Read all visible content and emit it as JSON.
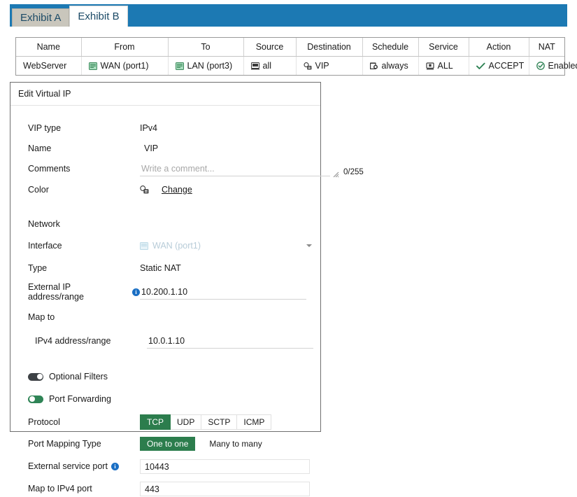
{
  "tabs": [
    {
      "label": "Exhibit A",
      "active": false
    },
    {
      "label": "Exhibit B",
      "active": true
    }
  ],
  "policy_table": {
    "headers": [
      "Name",
      "From",
      "To",
      "Source",
      "Destination",
      "Schedule",
      "Service",
      "Action",
      "NAT"
    ],
    "rows": [
      {
        "name": "WebServer",
        "from": "WAN (port1)",
        "from_icon": "interface-icon",
        "to": "LAN (port3)",
        "to_icon": "interface-icon",
        "source": "all",
        "source_icon": "address-icon",
        "destination": "VIP",
        "destination_icon": "vip-icon",
        "schedule": "always",
        "schedule_icon": "clock-icon",
        "service": "ALL",
        "service_icon": "service-icon",
        "action": "ACCEPT",
        "action_icon": "check-icon",
        "nat": "Enabled",
        "nat_icon": "check-circle-icon"
      }
    ]
  },
  "panel": {
    "title": "Edit Virtual IP",
    "fields": {
      "vip_type_label": "VIP type",
      "vip_type_value": "IPv4",
      "name_label": "Name",
      "name_value": "VIP",
      "comments_label": "Comments",
      "comments_value": "",
      "comments_placeholder": "Write a comment...",
      "comments_counter": "0/255",
      "color_label": "Color",
      "color_change_label": "Change",
      "color_icon": "color-palette-icon"
    },
    "network": {
      "section_label": "Network",
      "interface_label": "Interface",
      "interface_value": "WAN (port1)",
      "interface_icon": "interface-icon",
      "type_label": "Type",
      "type_value": "Static NAT",
      "external_ip_label": "External IP address/range",
      "external_ip_value": "10.200.1.10",
      "map_to_label": "Map to",
      "ipv4_range_label": "IPv4 address/range",
      "ipv4_range_value": "10.0.1.10"
    },
    "toggles": {
      "optional_filters_label": "Optional Filters",
      "optional_filters_on": false,
      "port_forwarding_label": "Port Forwarding",
      "port_forwarding_on": true
    },
    "port_forwarding": {
      "protocol_label": "Protocol",
      "protocol_options": [
        "TCP",
        "UDP",
        "SCTP",
        "ICMP"
      ],
      "protocol_selected": "TCP",
      "mapping_type_label": "Port Mapping Type",
      "mapping_type_options": [
        "One to one",
        "Many to many"
      ],
      "mapping_type_selected": "One to one",
      "external_service_port_label": "External service port",
      "external_service_port_value": "10443",
      "map_to_ipv4_port_label": "Map to IPv4 port",
      "map_to_ipv4_port_value": "443"
    }
  },
  "colors": {
    "tab_active_bg": "#ffffff",
    "tab_inactive_bg": "#c9c6bc",
    "tabbar_blue": "#1c79b3",
    "accent_green": "#2c7d4d",
    "toggle_on_green": "#2f8456",
    "info_blue": "#1a6fc4"
  }
}
